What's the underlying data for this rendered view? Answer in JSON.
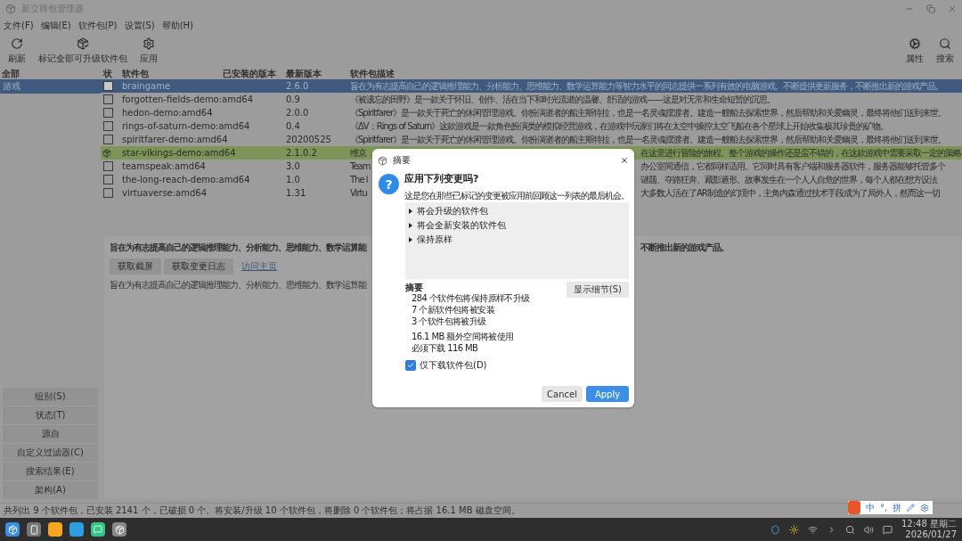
{
  "window": {
    "title": "新立得包管理器"
  },
  "menu": [
    {
      "label": "文件(F)"
    },
    {
      "label": "编辑(E)"
    },
    {
      "label": "软件包(P)"
    },
    {
      "label": "设置(S)"
    },
    {
      "label": "帮助(H)"
    }
  ],
  "toolbar": {
    "left": [
      {
        "label": "刷新"
      },
      {
        "label": "标记全部可升级软件包"
      },
      {
        "label": "应用"
      }
    ],
    "right": [
      {
        "label": "属性"
      },
      {
        "label": "搜索"
      }
    ]
  },
  "sidebar": {
    "header": "全部",
    "items": [
      {
        "label": "游戏",
        "selected": true
      }
    ],
    "filter_buttons": [
      "组别(S)",
      "状态(T)",
      "源自",
      "自定义过滤器(C)",
      "搜索结果(E)",
      "架构(A)"
    ]
  },
  "table": {
    "columns": [
      "状",
      "软件包",
      "已安装的版本",
      "最新版本",
      "软件包描述"
    ],
    "rows": [
      {
        "package": "braingame",
        "latest": "2.6.0",
        "description": "旨在为有志提高自己的逻辑推理能力、分析能力、思维能力、数学运算能力等智力水平的同志提供一系列有效的电脑游戏。不断提供更新服务，不断推出新的游戏产品。",
        "selected": true,
        "marked": false
      },
      {
        "package": "forgotten-fields-demo:amd64",
        "latest": "0.9",
        "description": "《被遗忘的田野》是一款关于怀旧、创作、活在当下和时光流逝的温馨、舒适的游戏——这是对无常和生命短暂的沉思。",
        "selected": false,
        "marked": false
      },
      {
        "package": "hedon-demo:amd64",
        "latest": "2.0.0",
        "description": "《Spiritfarer》是一款关于死亡的休闲管理游戏。你扮演逝者的船主斯特拉，也是一名灵魂摆渡者。建造一艘船去探索世界，然后帮助和关爱幽灵，最终将他们送到来世。",
        "selected": false,
        "marked": false
      },
      {
        "package": "rings-of-saturn-demo:amd64",
        "latest": "0.4",
        "description": "《ΔV：Rings of Saturn》这款游戏是一款角色扮演类的模拟经营游戏，在游戏中玩家们将在太空中操控太空飞船在各个星球上开始收集极其珍贵的矿物。",
        "selected": false,
        "marked": false
      },
      {
        "package": "spiritfarer-demo:amd64",
        "latest": "20200525",
        "description": "《Spiritfarer》是一款关于死亡的休闲管理游戏。你扮演逝者的船主斯特拉，也是一名灵魂摆渡者。建造一艘船去探索世界，然后帮助和关爱幽灵，最终将他们送到来世。",
        "selected": false,
        "marked": false
      },
      {
        "package": "star-vikings-demo:amd64",
        "latest": "2.1.0.2",
        "description": "维京",
        "description_tail": "在这里进行冒险的旅程。整个游戏的操作还是蛮不错的，在这款游戏中需要采取一定的策略",
        "selected": false,
        "marked": true
      },
      {
        "package": "teamspeak:amd64",
        "latest": "3.0",
        "description": "Team",
        "description_tail": "办公室间通信，它都同样适用。它同时具有客户端和服务器软件，服务器能够托管多个",
        "selected": false,
        "marked": false
      },
      {
        "package": "the-long-reach-demo:amd64",
        "latest": "1.0",
        "description": "The l",
        "description_tail": "谜题、夺路狂奔、藏影遁形。故事发生在一个人人自危的世界，每个人都在想方设法",
        "selected": false,
        "marked": false
      },
      {
        "package": "virtuaverse:amd64",
        "latest": "1.31",
        "description": "Virtu",
        "description_tail": "大多数人活在了AR制造的幻境中，主角内森通过技术手段成为了局外人，然而这一切",
        "selected": false,
        "marked": false
      }
    ]
  },
  "details": {
    "title": "旨在为有志提高自己的逻辑推理能力、分析能力、思维能力、数学运算能",
    "title_tail": "不断推出新的游戏产品。",
    "buttons": [
      "获取截屏",
      "获取变更日志"
    ],
    "link": "访问主页",
    "text": "旨在为有志提高自己的逻辑推理能力、分析能力、思维能力、数学运算能"
  },
  "status_bar": "共列出 9 个软件包，已安装 2141 个，已破损 0 个。将安装/升级 10 个软件包，将删除 0 个软件包；将占据 16.1 MB 磁盘空间。",
  "dialog": {
    "title": "摘要",
    "question_mark": "?",
    "heading": "应用下列变更吗?",
    "message": "这是您在那些已标记的变更被应用前回顾这一列表的最后机会。",
    "tree": [
      {
        "label": "将会升级的软件包",
        "expanded": false
      },
      {
        "label": "将会全新安装的软件包",
        "expanded": false
      },
      {
        "label": "保持原样",
        "expanded": false
      }
    ],
    "summary_label": "摘要",
    "details_button": "显示细节(S)",
    "summary_groups": [
      [
        "284 个软件包将保持原样不升级",
        "7 个新软件包将被安装",
        "3 个软件包将被升级"
      ],
      [
        "16.1 MB 额外空间将被使用",
        "必须下载 116 MB"
      ]
    ],
    "download_only": {
      "label": "仅下载软件包(D)",
      "checked": true
    },
    "buttons": [
      {
        "label": "Cancel",
        "kind": "secondary"
      },
      {
        "label": "Apply",
        "kind": "primary"
      }
    ]
  },
  "ime": {
    "items": [
      "中",
      "°,",
      "拼"
    ]
  },
  "taskbar": {
    "time": "12:48 星期二",
    "date": "2026/01/27"
  }
}
